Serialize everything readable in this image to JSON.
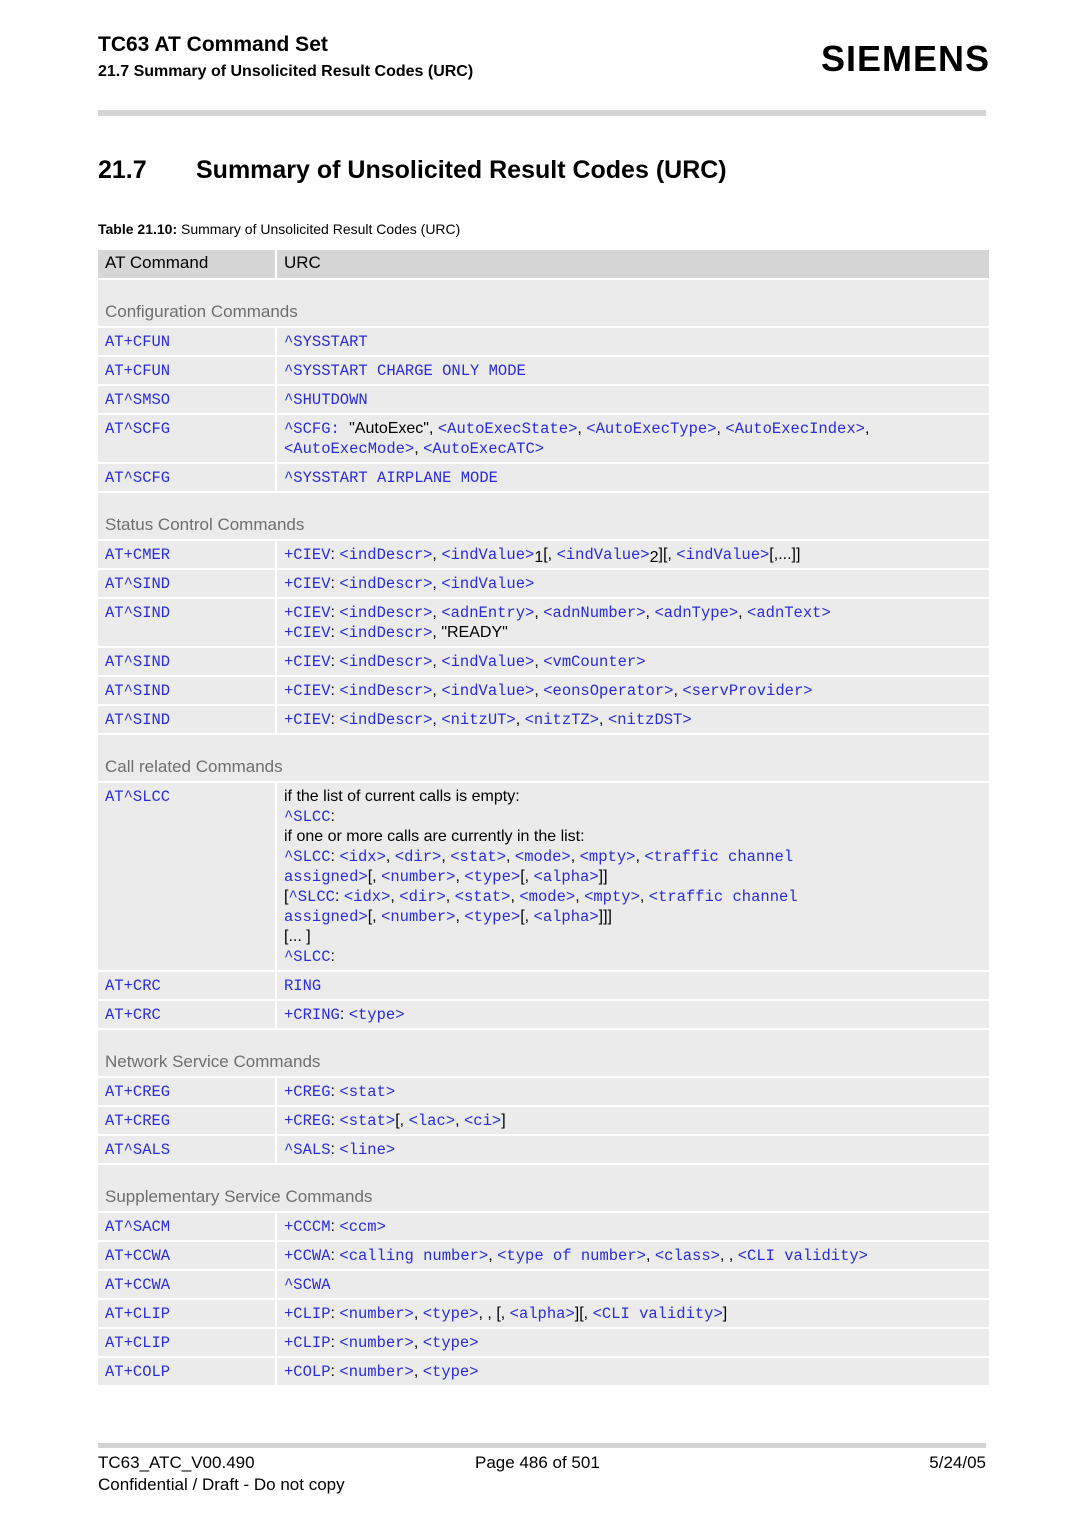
{
  "header": {
    "doc_title": "TC63 AT Command Set",
    "doc_subtitle": "21.7 Summary of Unsolicited Result Codes (URC)",
    "logo": "SIEMENS"
  },
  "section": {
    "number": "21.7",
    "title": "Summary of Unsolicited Result Codes (URC)"
  },
  "caption": {
    "label": "Table 21.10:",
    "text": " Summary of Unsolicited Result Codes (URC)"
  },
  "table": {
    "columns": [
      "AT Command",
      "URC"
    ],
    "groups": [
      {
        "title": "Configuration Commands",
        "rows": [
          {
            "cmd": "AT+CFUN",
            "urc": [
              [
                [
                  "m",
                  "^SYSSTART"
                ]
              ]
            ]
          },
          {
            "cmd": "AT+CFUN",
            "urc": [
              [
                [
                  "m",
                  "^SYSSTART CHARGE ONLY MODE"
                ]
              ]
            ]
          },
          {
            "cmd": "AT^SMSO",
            "urc": [
              [
                [
                  "m",
                  "^SHUTDOWN"
                ]
              ]
            ]
          },
          {
            "cmd": "AT^SCFG",
            "urc": [
              [
                [
                  "m",
                  "^SCFG: "
                ],
                [
                  "p",
                  "\"AutoExec\", "
                ],
                [
                  "m",
                  "<AutoExecState>"
                ],
                [
                  "p",
                  ", "
                ],
                [
                  "m",
                  "<AutoExecType>"
                ],
                [
                  "p",
                  ", "
                ],
                [
                  "m",
                  "<AutoExecIndex>"
                ],
                [
                  "p",
                  ","
                ]
              ],
              [
                [
                  "m",
                  "<AutoExecMode>"
                ],
                [
                  "p",
                  ", "
                ],
                [
                  "m",
                  "<AutoExecATC>"
                ]
              ]
            ]
          },
          {
            "cmd": "AT^SCFG",
            "urc": [
              [
                [
                  "m",
                  "^SYSSTART AIRPLANE MODE"
                ]
              ]
            ]
          }
        ]
      },
      {
        "title": "Status Control Commands",
        "rows": [
          {
            "cmd": "AT+CMER",
            "urc": [
              [
                [
                  "m",
                  "+CIEV"
                ],
                [
                  "p",
                  ": "
                ],
                [
                  "m",
                  "<indDescr>"
                ],
                [
                  "p",
                  ", "
                ],
                [
                  "m",
                  "<indValue>"
                ],
                [
                  "s",
                  "1"
                ],
                [
                  "p",
                  "[, "
                ],
                [
                  "m",
                  "<indValue>"
                ],
                [
                  "s",
                  "2"
                ],
                [
                  "p",
                  "][, "
                ],
                [
                  "m",
                  "<indValue>"
                ],
                [
                  "p",
                  "[,...]]"
                ]
              ]
            ]
          },
          {
            "cmd": "AT^SIND",
            "urc": [
              [
                [
                  "m",
                  "+CIEV"
                ],
                [
                  "p",
                  ": "
                ],
                [
                  "m",
                  "<indDescr>"
                ],
                [
                  "p",
                  ", "
                ],
                [
                  "m",
                  "<indValue>"
                ]
              ]
            ]
          },
          {
            "cmd": "AT^SIND",
            "urc": [
              [
                [
                  "m",
                  "+CIEV"
                ],
                [
                  "p",
                  ": "
                ],
                [
                  "m",
                  "<indDescr>"
                ],
                [
                  "p",
                  ", "
                ],
                [
                  "m",
                  "<adnEntry>"
                ],
                [
                  "p",
                  ", "
                ],
                [
                  "m",
                  "<adnNumber>"
                ],
                [
                  "p",
                  ", "
                ],
                [
                  "m",
                  "<adnType>"
                ],
                [
                  "p",
                  ", "
                ],
                [
                  "m",
                  "<adnText>"
                ]
              ],
              [
                [
                  "m",
                  "+CIEV"
                ],
                [
                  "p",
                  ": "
                ],
                [
                  "m",
                  "<indDescr>"
                ],
                [
                  "p",
                  ", \"READY\""
                ]
              ]
            ]
          },
          {
            "cmd": "AT^SIND",
            "urc": [
              [
                [
                  "m",
                  "+CIEV"
                ],
                [
                  "p",
                  ": "
                ],
                [
                  "m",
                  "<indDescr>"
                ],
                [
                  "p",
                  ", "
                ],
                [
                  "m",
                  "<indValue>"
                ],
                [
                  "p",
                  ", "
                ],
                [
                  "m",
                  "<vmCounter>"
                ]
              ]
            ]
          },
          {
            "cmd": "AT^SIND",
            "urc": [
              [
                [
                  "m",
                  "+CIEV"
                ],
                [
                  "p",
                  ": "
                ],
                [
                  "m",
                  "<indDescr>"
                ],
                [
                  "p",
                  ", "
                ],
                [
                  "m",
                  "<indValue>"
                ],
                [
                  "p",
                  ", "
                ],
                [
                  "m",
                  "<eonsOperator>"
                ],
                [
                  "p",
                  ", "
                ],
                [
                  "m",
                  "<servProvider>"
                ]
              ]
            ]
          },
          {
            "cmd": "AT^SIND",
            "urc": [
              [
                [
                  "m",
                  "+CIEV"
                ],
                [
                  "p",
                  ": "
                ],
                [
                  "m",
                  "<indDescr>"
                ],
                [
                  "p",
                  ", "
                ],
                [
                  "m",
                  "<nitzUT>"
                ],
                [
                  "p",
                  ", "
                ],
                [
                  "m",
                  "<nitzTZ>"
                ],
                [
                  "p",
                  ", "
                ],
                [
                  "m",
                  "<nitzDST>"
                ]
              ]
            ]
          }
        ]
      },
      {
        "title": "Call related Commands",
        "rows": [
          {
            "cmd": "AT^SLCC",
            "urc": [
              [
                [
                  "p",
                  "if the list of current calls is empty:"
                ]
              ],
              [
                [
                  "m",
                  "^SLCC"
                ],
                [
                  "p",
                  ":"
                ]
              ],
              [
                [
                  "p",
                  "if one or more calls are currently in the list:"
                ]
              ],
              [
                [
                  "m",
                  "^SLCC"
                ],
                [
                  "p",
                  ": "
                ],
                [
                  "m",
                  "<idx>"
                ],
                [
                  "p",
                  ", "
                ],
                [
                  "m",
                  "<dir>"
                ],
                [
                  "p",
                  ", "
                ],
                [
                  "m",
                  "<stat>"
                ],
                [
                  "p",
                  ", "
                ],
                [
                  "m",
                  "<mode>"
                ],
                [
                  "p",
                  ", "
                ],
                [
                  "m",
                  "<mpty>"
                ],
                [
                  "p",
                  ", "
                ],
                [
                  "m",
                  "<traffic channel"
                ]
              ],
              [
                [
                  "m",
                  "assigned>"
                ],
                [
                  "p",
                  "[, "
                ],
                [
                  "m",
                  "<number>"
                ],
                [
                  "p",
                  ", "
                ],
                [
                  "m",
                  "<type>"
                ],
                [
                  "p",
                  "[, "
                ],
                [
                  "m",
                  "<alpha>"
                ],
                [
                  "p",
                  "]]"
                ]
              ],
              [
                [
                  "p",
                  "["
                ],
                [
                  "m",
                  "^SLCC"
                ],
                [
                  "p",
                  ": "
                ],
                [
                  "m",
                  "<idx>"
                ],
                [
                  "p",
                  ", "
                ],
                [
                  "m",
                  "<dir>"
                ],
                [
                  "p",
                  ", "
                ],
                [
                  "m",
                  "<stat>"
                ],
                [
                  "p",
                  ", "
                ],
                [
                  "m",
                  "<mode>"
                ],
                [
                  "p",
                  ", "
                ],
                [
                  "m",
                  "<mpty>"
                ],
                [
                  "p",
                  ", "
                ],
                [
                  "m",
                  "<traffic channel"
                ]
              ],
              [
                [
                  "m",
                  "assigned>"
                ],
                [
                  "p",
                  "[, "
                ],
                [
                  "m",
                  "<number>"
                ],
                [
                  "p",
                  ", "
                ],
                [
                  "m",
                  "<type>"
                ],
                [
                  "p",
                  "[, "
                ],
                [
                  "m",
                  "<alpha>"
                ],
                [
                  "p",
                  "]]]"
                ]
              ],
              [
                [
                  "p",
                  "[... ]"
                ]
              ],
              [
                [
                  "m",
                  "^SLCC"
                ],
                [
                  "p",
                  ":"
                ]
              ]
            ]
          },
          {
            "cmd": "AT+CRC",
            "urc": [
              [
                [
                  "m",
                  "RING"
                ]
              ]
            ]
          },
          {
            "cmd": "AT+CRC",
            "urc": [
              [
                [
                  "m",
                  "+CRING"
                ],
                [
                  "p",
                  ": "
                ],
                [
                  "m",
                  "<type>"
                ]
              ]
            ]
          }
        ]
      },
      {
        "title": "Network Service Commands",
        "rows": [
          {
            "cmd": "AT+CREG",
            "urc": [
              [
                [
                  "m",
                  "+CREG"
                ],
                [
                  "p",
                  ": "
                ],
                [
                  "m",
                  "<stat>"
                ]
              ]
            ]
          },
          {
            "cmd": "AT+CREG",
            "urc": [
              [
                [
                  "m",
                  "+CREG"
                ],
                [
                  "p",
                  ": "
                ],
                [
                  "m",
                  "<stat>"
                ],
                [
                  "p",
                  "[, "
                ],
                [
                  "m",
                  "<lac>"
                ],
                [
                  "p",
                  ", "
                ],
                [
                  "m",
                  "<ci>"
                ],
                [
                  "p",
                  "]"
                ]
              ]
            ]
          },
          {
            "cmd": "AT^SALS",
            "urc": [
              [
                [
                  "m",
                  "^SALS"
                ],
                [
                  "p",
                  ": "
                ],
                [
                  "m",
                  "<line>"
                ]
              ]
            ]
          }
        ]
      },
      {
        "title": "Supplementary Service Commands",
        "rows": [
          {
            "cmd": "AT^SACM",
            "urc": [
              [
                [
                  "m",
                  "+CCCM"
                ],
                [
                  "p",
                  ": "
                ],
                [
                  "m",
                  "<ccm>"
                ]
              ]
            ]
          },
          {
            "cmd": "AT+CCWA",
            "urc": [
              [
                [
                  "m",
                  "+CCWA"
                ],
                [
                  "p",
                  ": "
                ],
                [
                  "m",
                  "<calling number>"
                ],
                [
                  "p",
                  ", "
                ],
                [
                  "m",
                  "<type of number>"
                ],
                [
                  "p",
                  ", "
                ],
                [
                  "m",
                  "<class>"
                ],
                [
                  "p",
                  ", , "
                ],
                [
                  "m",
                  "<CLI validity>"
                ]
              ]
            ]
          },
          {
            "cmd": "AT+CCWA",
            "urc": [
              [
                [
                  "m",
                  "^SCWA"
                ]
              ]
            ]
          },
          {
            "cmd": "AT+CLIP",
            "urc": [
              [
                [
                  "m",
                  "+CLIP"
                ],
                [
                  "p",
                  ": "
                ],
                [
                  "m",
                  "<number>"
                ],
                [
                  "p",
                  ", "
                ],
                [
                  "m",
                  "<type>"
                ],
                [
                  "p",
                  ", , [, "
                ],
                [
                  "m",
                  "<alpha>"
                ],
                [
                  "p",
                  "][, "
                ],
                [
                  "m",
                  "<CLI validity>"
                ],
                [
                  "p",
                  "]"
                ]
              ]
            ]
          },
          {
            "cmd": "AT+CLIP",
            "urc": [
              [
                [
                  "m",
                  "+CLIP"
                ],
                [
                  "p",
                  ": "
                ],
                [
                  "m",
                  "<number>"
                ],
                [
                  "p",
                  ", "
                ],
                [
                  "m",
                  "<type>"
                ]
              ]
            ]
          },
          {
            "cmd": "AT+COLP",
            "urc": [
              [
                [
                  "m",
                  "+COLP"
                ],
                [
                  "p",
                  ": "
                ],
                [
                  "m",
                  "<number>"
                ],
                [
                  "p",
                  ", "
                ],
                [
                  "m",
                  "<type>"
                ]
              ]
            ]
          }
        ]
      }
    ]
  },
  "footer": {
    "doc_id": "TC63_ATC_V00.490",
    "page": "Page 486 of 501",
    "date": "5/24/05",
    "confidential": "Confidential / Draft - Do not copy"
  },
  "colors": {
    "link": "#2b2bd9",
    "group_text": "#6e6e6e",
    "header_bg": "#d6d6d6",
    "row_bg": "#ebebeb"
  }
}
